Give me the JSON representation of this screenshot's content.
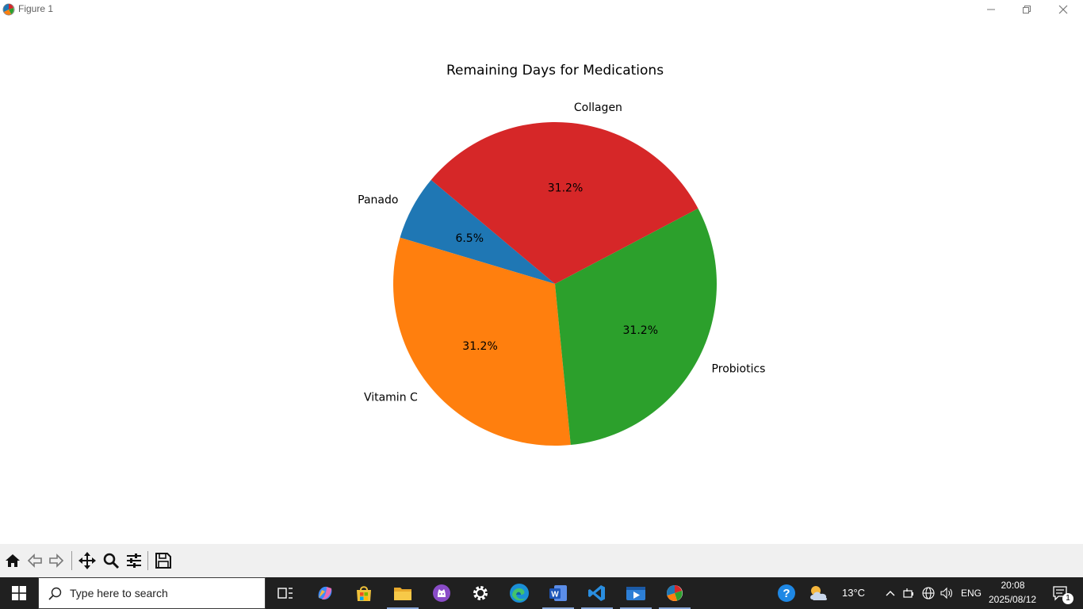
{
  "window": {
    "title": "Figure 1",
    "controls": [
      "minimize",
      "maximize",
      "close"
    ]
  },
  "chart_data": {
    "type": "pie",
    "title": "Remaining Days for Medications",
    "slices": [
      {
        "label": "Panado",
        "percent": 6.5,
        "pct_text": "6.5%",
        "color": "#1f77b4"
      },
      {
        "label": "Vitamin C",
        "percent": 31.2,
        "pct_text": "31.2%",
        "color": "#ff7f0e"
      },
      {
        "label": "Probiotics",
        "percent": 31.2,
        "pct_text": "31.2%",
        "color": "#2ca02c"
      },
      {
        "label": "Collagen",
        "percent": 31.2,
        "pct_text": "31.2%",
        "color": "#d62728"
      }
    ],
    "start_angle": 140,
    "legend": "none"
  },
  "toolbar": {
    "buttons": [
      "home-icon",
      "back-icon",
      "forward-icon",
      "pan-icon",
      "zoom-icon",
      "configure-subplots-icon",
      "save-icon"
    ]
  },
  "taskbar": {
    "search_placeholder": "Type here to search",
    "apps": [
      "task-view-icon",
      "copilot-icon",
      "microsoft-store-icon",
      "file-explorer-icon",
      "github-desktop-icon",
      "settings-icon",
      "edge-icon",
      "word-icon",
      "vscode-icon",
      "media-player-icon",
      "python-figure-icon"
    ],
    "weather_temp": "13°C",
    "language": "ENG",
    "time": "20:08",
    "date": "2025/08/12",
    "notification_count": "1"
  }
}
